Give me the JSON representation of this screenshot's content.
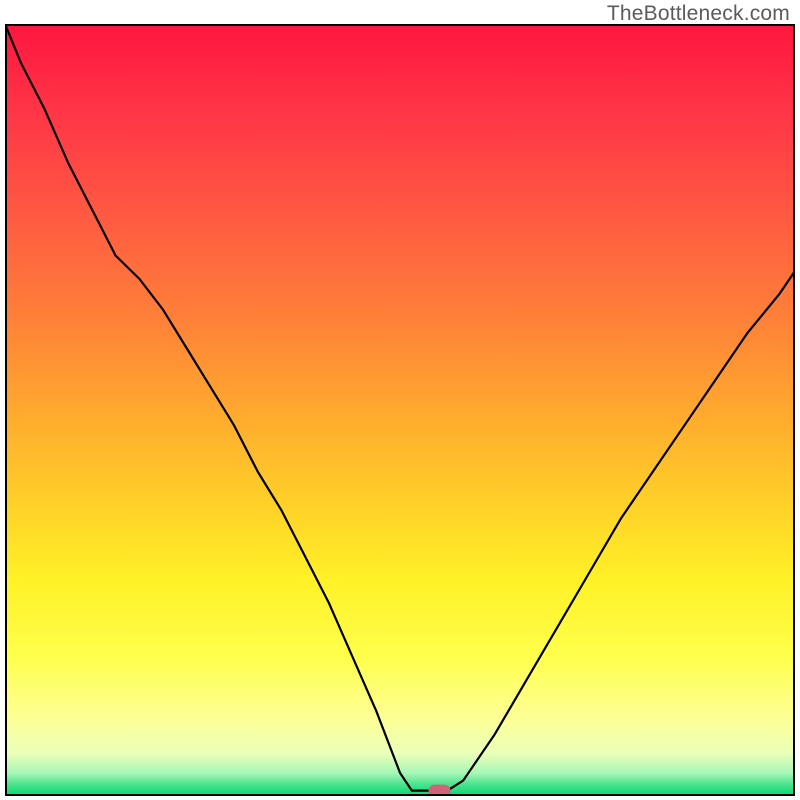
{
  "watermark": "TheBottleneck.com",
  "chart_data": {
    "type": "line",
    "title": "",
    "xlabel": "",
    "ylabel": "",
    "xlim": [
      0,
      100
    ],
    "ylim": [
      0,
      100
    ],
    "series": [
      {
        "name": "curve",
        "x": [
          0,
          2,
          5,
          8,
          11,
          14,
          17,
          20,
          23,
          26,
          29,
          32,
          35,
          38,
          41,
          44,
          47,
          50,
          51.5,
          54,
          56,
          58,
          62,
          66,
          70,
          74,
          78,
          82,
          86,
          90,
          94,
          98,
          100
        ],
        "y": [
          100,
          95,
          89,
          82,
          76,
          70,
          67,
          63,
          58,
          53,
          48,
          42,
          37,
          31,
          25,
          18,
          11,
          3,
          0.7,
          0.7,
          0.7,
          2,
          8,
          15,
          22,
          29,
          36,
          42,
          48,
          54,
          60,
          65,
          68
        ],
        "stroke": "#000000",
        "stroke_width": 2.2
      }
    ],
    "marker": {
      "cx": 55,
      "cy": 0.7,
      "fill": "#d0637a",
      "label": "datum-marker"
    },
    "background": {
      "gradient_stops": [
        {
          "offset": 0.0,
          "color": "#ff163f"
        },
        {
          "offset": 0.12,
          "color": "#ff3747"
        },
        {
          "offset": 0.25,
          "color": "#ff5a42"
        },
        {
          "offset": 0.38,
          "color": "#ff8038"
        },
        {
          "offset": 0.5,
          "color": "#ffa82f"
        },
        {
          "offset": 0.62,
          "color": "#ffd028"
        },
        {
          "offset": 0.72,
          "color": "#fff127"
        },
        {
          "offset": 0.82,
          "color": "#ffff4c"
        },
        {
          "offset": 0.9,
          "color": "#fdff96"
        },
        {
          "offset": 0.945,
          "color": "#eaffb9"
        },
        {
          "offset": 0.97,
          "color": "#a8f7b7"
        },
        {
          "offset": 0.985,
          "color": "#4be38e"
        },
        {
          "offset": 1.0,
          "color": "#00d873"
        }
      ]
    },
    "frame_color": "#000000",
    "frame_width": 4
  }
}
